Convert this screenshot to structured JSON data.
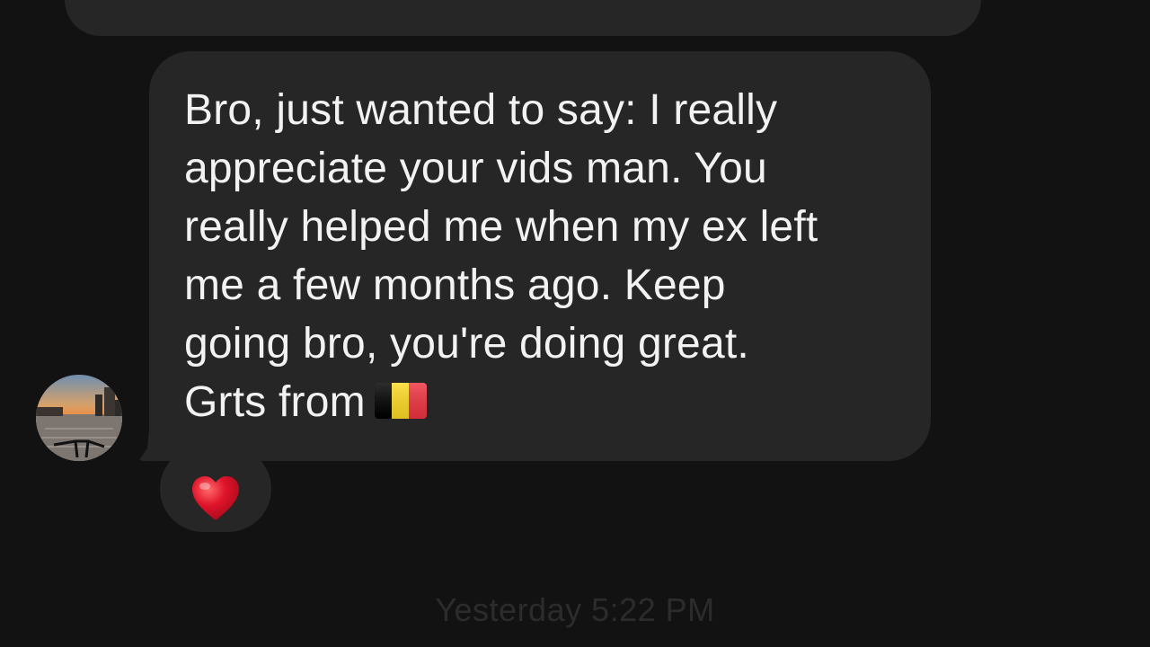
{
  "message": {
    "lines": [
      "Bro, just wanted to say: I really",
      "appreciate your vids man. You",
      "really helped me when my ex left",
      "me a few months ago. Keep",
      "going bro, you're doing great.",
      "Grts from"
    ],
    "flag_icon": "belgium-flag-icon",
    "flag_colors": [
      "#000000",
      "#FDDA24",
      "#EF3340"
    ]
  },
  "reaction": {
    "icon": "red-heart-icon",
    "color": "#E0142B"
  },
  "sender": {
    "avatar_icon": "avatar-photo-sunset-street-icon"
  },
  "timestamp": "Yesterday 5:22 PM",
  "colors": {
    "background": "#121212",
    "bubble": "#262626",
    "text": "#F2F2F2",
    "timestamp": "#2C2C2C"
  }
}
